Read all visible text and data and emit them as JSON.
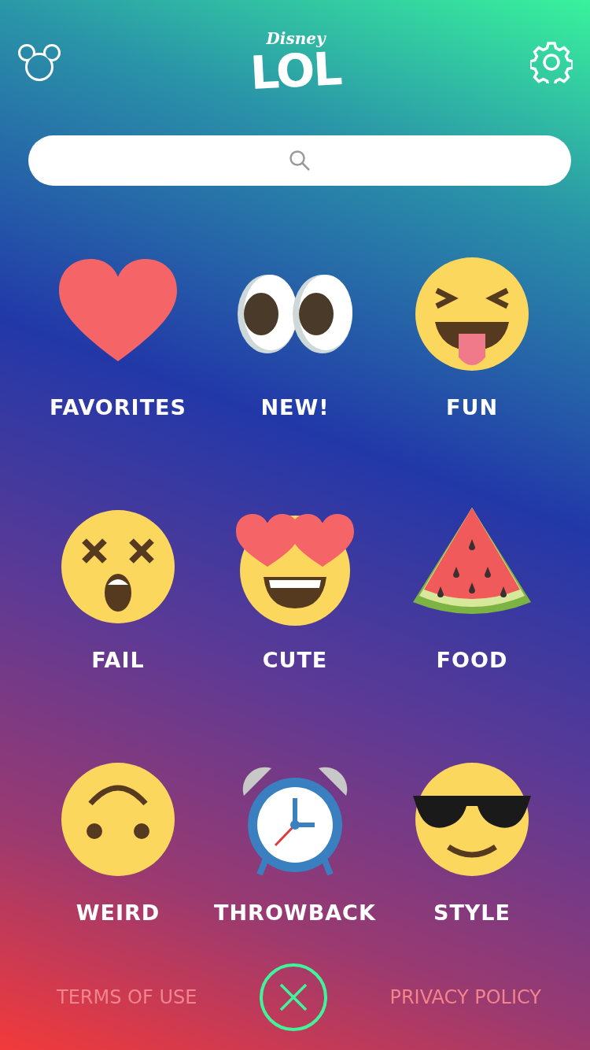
{
  "header": {
    "logo_top": "Disney",
    "logo_main": "LOL"
  },
  "categories": [
    {
      "label": "FAVORITES",
      "kind": "heart"
    },
    {
      "label": "NEW!",
      "kind": "eyes"
    },
    {
      "label": "FUN",
      "kind": "tongue"
    },
    {
      "label": "FAIL",
      "kind": "dizzy"
    },
    {
      "label": "CUTE",
      "kind": "hearteyes"
    },
    {
      "label": "FOOD",
      "kind": "watermelon"
    },
    {
      "label": "WEIRD",
      "kind": "upside"
    },
    {
      "label": "THROWBACK",
      "kind": "clock"
    },
    {
      "label": "STYLE",
      "kind": "shades"
    }
  ],
  "footer": {
    "left_link": "TERMS OF USE",
    "right_link": "PRIVACY POLICY"
  }
}
